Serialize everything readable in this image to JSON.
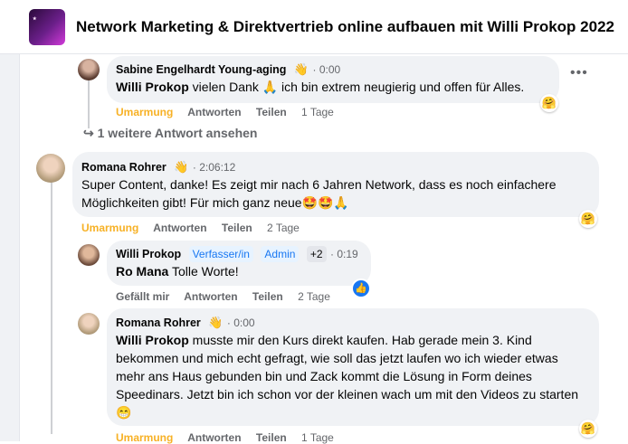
{
  "header": {
    "title": "Network Marketing & Direktvertrieb online aufbauen mit Willi Prokop 2022"
  },
  "comments": [
    {
      "author": "Sabine Engelhardt Young-aging",
      "time": "0:00",
      "mention": "Willi Prokop",
      "text": "vielen Dank 🙏 ich bin extrem neugierig und offen für Alles.",
      "actions": {
        "react": "Umarmung",
        "reply": "Antworten",
        "share": "Teilen",
        "age": "1 Tage"
      }
    },
    {
      "author": "Romana Rohrer",
      "time": "2:06:12",
      "text": "Super Content, danke! Es zeigt mir nach 6 Jahren Network, dass es noch einfachere Möglichkeiten gibt! Für mich ganz neue🤩🤩🙏",
      "actions": {
        "react": "Umarmung",
        "reply": "Antworten",
        "share": "Teilen",
        "age": "2 Tage"
      }
    },
    {
      "author": "Willi Prokop",
      "badge1": "Verfasser/in",
      "badge2": "Admin",
      "plus": "+2",
      "time": "0:19",
      "mention": "Ro Mana",
      "text": "Tolle Worte!",
      "actions": {
        "react": "Gefällt mir",
        "reply": "Antworten",
        "share": "Teilen",
        "age": "2 Tage"
      }
    },
    {
      "author": "Romana Rohrer",
      "time": "0:00",
      "mention": "Willi Prokop",
      "text": "musste mir den Kurs direkt kaufen. Hab gerade mein 3. Kind bekommen und mich echt gefragt, wie soll das jetzt laufen wo ich wieder etwas mehr ans Haus gebunden bin und Zack kommt die Lösung in Form deines Speedinars. Jetzt bin ich schon vor der kleinen wach um mit den Videos zu starten😁",
      "actions": {
        "react": "Umarmung",
        "reply": "Antworten",
        "share": "Teilen",
        "age": "1 Tage"
      }
    }
  ],
  "more_replies": "1 weitere Antwort ansehen",
  "icons": {
    "wave": "wave-icon",
    "reply_arrow": "reply-arrow-icon",
    "more": "more-options-icon",
    "hug": "hug-reaction-icon",
    "like": "like-icon"
  },
  "colors": {
    "bubble": "#f0f2f5",
    "meta": "#65676b",
    "hug": "#f7b125",
    "badge": "#1877f2"
  }
}
